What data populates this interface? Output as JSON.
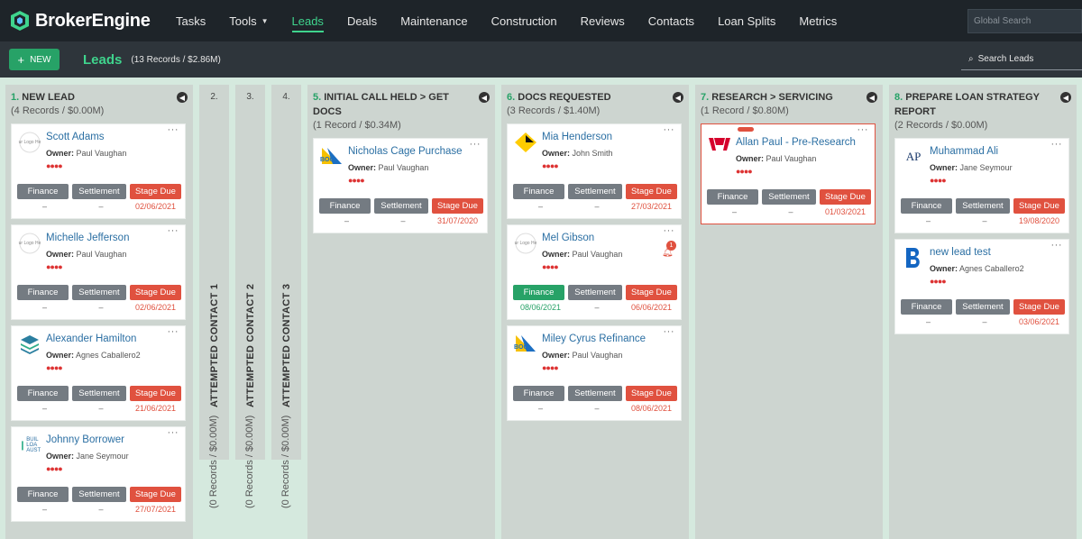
{
  "app": {
    "name": "BrokerEngine"
  },
  "nav": {
    "items": [
      {
        "label": "Tasks"
      },
      {
        "label": "Tools"
      },
      {
        "label": "Leads"
      },
      {
        "label": "Deals"
      },
      {
        "label": "Maintenance"
      },
      {
        "label": "Construction"
      },
      {
        "label": "Reviews"
      },
      {
        "label": "Contacts"
      },
      {
        "label": "Loan Splits"
      },
      {
        "label": "Metrics"
      }
    ],
    "global_search_placeholder": "Global Search"
  },
  "subbar": {
    "new_label": "NEW",
    "title": "Leads",
    "count": "(13 Records / $2.86M)",
    "search_placeholder": "Search Leads"
  },
  "labels": {
    "owner": "Owner:",
    "finance": "Finance",
    "settlement": "Settlement",
    "stage_due": "Stage Due"
  },
  "columns": [
    {
      "num": "1.",
      "title": "NEW LEAD",
      "sub": "(4 Records / $0.00M)",
      "cards": [
        {
          "name": "Scott Adams",
          "owner": "Paul Vaughan",
          "fin_date": "–",
          "set_date": "–",
          "due_date": "02/06/2021"
        },
        {
          "name": "Michelle Jefferson",
          "owner": "Paul Vaughan",
          "fin_date": "–",
          "set_date": "–",
          "due_date": "02/06/2021"
        },
        {
          "name": "Alexander Hamilton",
          "owner": "Agnes Caballero2",
          "fin_date": "–",
          "set_date": "–",
          "due_date": "21/06/2021"
        },
        {
          "name": "Johnny Borrower",
          "owner": "Jane Seymour",
          "fin_date": "–",
          "set_date": "–",
          "due_date": "27/07/2021"
        }
      ]
    },
    {
      "num": "2.",
      "title": "ATTEMPTED CONTACT 1",
      "sub": "(0 Records / $0.00M)"
    },
    {
      "num": "3.",
      "title": "ATTEMPTED CONTACT 2",
      "sub": "(0 Records / $0.00M)"
    },
    {
      "num": "4.",
      "title": "ATTEMPTED CONTACT 3",
      "sub": "(0 Records / $0.00M)"
    },
    {
      "num": "5.",
      "title": "INITIAL CALL HELD > GET DOCS",
      "sub": "(1 Record / $0.34M)",
      "cards": [
        {
          "name": "Nicholas Cage Purchase",
          "owner": "Paul Vaughan",
          "fin_date": "–",
          "set_date": "–",
          "due_date": "31/07/2020"
        }
      ]
    },
    {
      "num": "6.",
      "title": "DOCS REQUESTED",
      "sub": "(3 Records / $1.40M)",
      "cards": [
        {
          "name": "Mia Henderson",
          "owner": "John Smith",
          "fin_date": "–",
          "set_date": "–",
          "due_date": "27/03/2021"
        },
        {
          "name": "Mel Gibson",
          "owner": "Paul Vaughan",
          "fin_date": "08/06/2021",
          "set_date": "–",
          "due_date": "06/06/2021",
          "notif": "1"
        },
        {
          "name": "Miley Cyrus Refinance",
          "owner": "Paul Vaughan",
          "fin_date": "–",
          "set_date": "–",
          "due_date": "08/06/2021"
        }
      ]
    },
    {
      "num": "7.",
      "title": "RESEARCH > SERVICING",
      "sub": "(1 Record / $0.80M)",
      "cards": [
        {
          "name": "Allan Paul - Pre-Research",
          "owner": "Paul Vaughan",
          "fin_date": "–",
          "set_date": "–",
          "due_date": "01/03/2021"
        }
      ]
    },
    {
      "num": "8.",
      "title": "PREPARE LOAN STRATEGY",
      "title2": "REPORT",
      "sub": "(2 Records / $0.00M)",
      "cards": [
        {
          "name": "Muhammad Ali",
          "owner": "Jane Seymour",
          "fin_date": "–",
          "set_date": "–",
          "due_date": "19/08/2020"
        },
        {
          "name": "new lead test",
          "owner": "Agnes Caballero2",
          "fin_date": "–",
          "set_date": "–",
          "due_date": "03/06/2021"
        }
      ]
    }
  ],
  "logo_texts": {
    "placeholder": "ur Logo He",
    "bul": "BUIL LOA AUST",
    "boq": "BOQ",
    "ap": "AP"
  },
  "colors": {
    "accent": "#27a267",
    "active_nav": "#3fd48d",
    "due": "#e0513f",
    "link": "#2b6fa3"
  }
}
